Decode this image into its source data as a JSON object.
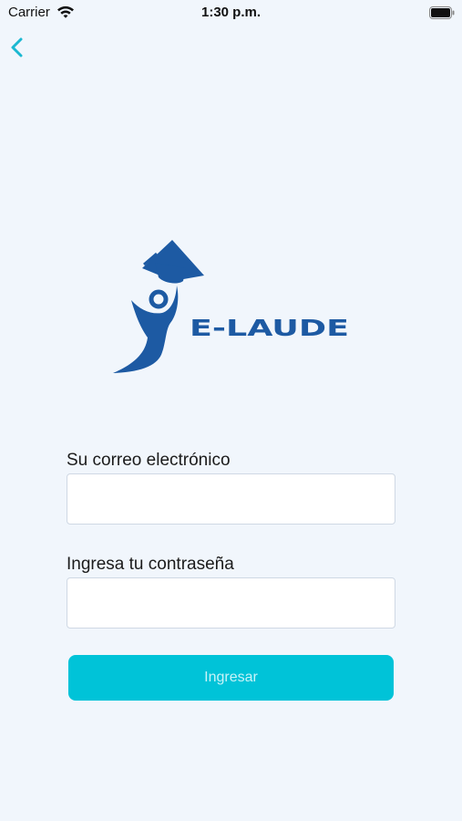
{
  "status_bar": {
    "carrier": "Carrier",
    "time": "1:30 p.m."
  },
  "nav": {
    "back_icon": "chevron-left-icon"
  },
  "logo": {
    "brand_text": "E-LAUDE",
    "color": "#1d5aa3"
  },
  "form": {
    "email_label": "Su correo electrónico",
    "email_value": "",
    "password_label": "Ingresa tu contraseña",
    "password_value": "",
    "submit_label": "Ingresar"
  },
  "colors": {
    "accent": "#00c3d8",
    "back_icon": "#1bb8d1",
    "background": "#f1f6fc"
  }
}
